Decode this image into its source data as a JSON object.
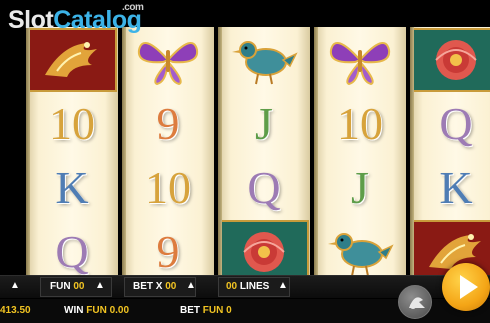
{
  "logo": {
    "brand_a": "Slot",
    "brand_b": "Catalog",
    "suffix": ".com"
  },
  "reels": [
    [
      "phoenix",
      "10",
      "K",
      "Q"
    ],
    [
      "butterfly",
      "9",
      "10",
      "9"
    ],
    [
      "bird",
      "J",
      "Q",
      "peony"
    ],
    [
      "butterfly",
      "10",
      "J",
      "bird"
    ],
    [
      "peony",
      "Q",
      "K",
      "phoenix"
    ]
  ],
  "controls": {
    "coin_label": "FUN",
    "coin_value": "00",
    "bet_label": "BET X",
    "bet_value": "00",
    "lines_value": "00",
    "lines_label": "LINES",
    "balance": "413.50",
    "win_label": "WIN",
    "win_currency": "FUN",
    "win_value": "0.00",
    "bet_footer_label": "BET",
    "bet_footer_currency": "FUN",
    "bet_footer_value": "0"
  },
  "icons": {
    "spin": "play-triangle-icon",
    "autoplay": "autoplay-icon",
    "arrow": "chevron-up-icon"
  },
  "colors": {
    "spin_button": "#f4a516",
    "value_yellow": "#f2c422",
    "logo_blue": "#3cb3e8"
  }
}
